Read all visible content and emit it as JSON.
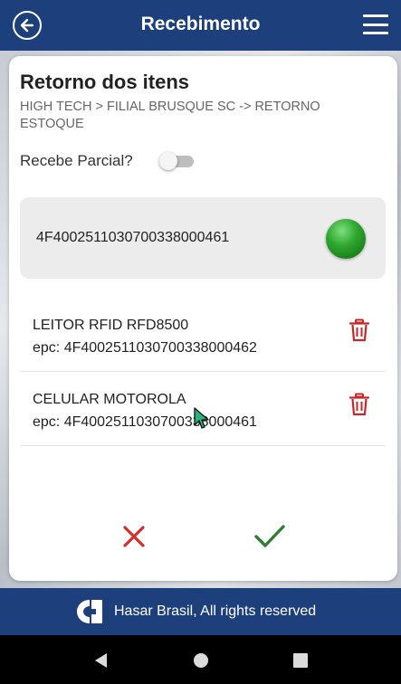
{
  "header": {
    "title": "Recebimento",
    "back_icon": "back-arrow-circle-icon",
    "menu_icon": "hamburger-menu-icon"
  },
  "page": {
    "heading": "Retorno dos itens",
    "path": "HIGH TECH > FILIAL BRUSQUE SC -> RETORNO ESTOQUE",
    "partial_label": "Recebe Parcial?",
    "partial_on": false
  },
  "scan": {
    "code": "4F4002511030700338000461",
    "status_color": "#2fa82f"
  },
  "items": [
    {
      "name": "LEITOR RFID RFD8500",
      "epc": "epc: 4F4002511030700338000462"
    },
    {
      "name": "CELULAR MOTOROLA",
      "epc": "epc: 4F4002511030700338000461"
    }
  ],
  "colors": {
    "brand": "#1d3f7c",
    "cancel": "#d32f2f",
    "confirm": "#2e7d32",
    "trash": "#c62828"
  },
  "footer": {
    "text": "Hasar Brasil, All rights reserved"
  }
}
